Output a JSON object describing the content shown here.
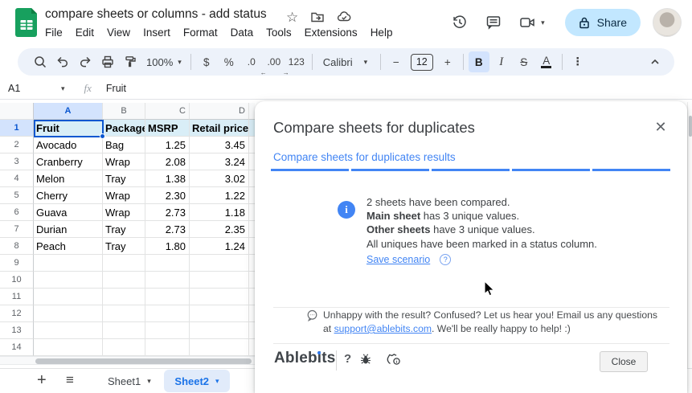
{
  "titlebar": {
    "doc_title": "compare sheets or columns - add status",
    "menu_items": [
      "File",
      "Edit",
      "View",
      "Insert",
      "Format",
      "Data",
      "Tools",
      "Extensions",
      "Help"
    ],
    "share_label": "Share"
  },
  "toolbar": {
    "zoom_value": "100%",
    "currency": "$",
    "percent": "%",
    "decimal_decrease": ".0",
    "decimal_increase": ".00",
    "more_formats": "123",
    "font_name": "Calibri",
    "minus": "−",
    "font_size": "12",
    "plus": "+",
    "bold": "B",
    "italic": "I",
    "strikethrough": "S",
    "text_color": "A",
    "more": "⋮"
  },
  "icons": {
    "caret_down": "▾",
    "arrow_left": "←",
    "arrow_right": "→",
    "star": "☆",
    "plus": "+",
    "all_sheets": "≡",
    "close": "✕",
    "question": "?",
    "info": "i"
  },
  "formula_bar": {
    "cell_ref": "A1",
    "fx_label": "fx",
    "value": "Fruit"
  },
  "grid": {
    "col_headers": [
      "A",
      "B",
      "C",
      "D"
    ],
    "row_numbers": [
      "1",
      "2",
      "3",
      "4",
      "5",
      "6",
      "7",
      "8",
      "9",
      "10",
      "11",
      "12",
      "13",
      "14"
    ],
    "rows": [
      [
        "Fruit",
        "Package",
        "MSRP",
        "Retail price"
      ],
      [
        "Avocado",
        "Bag",
        "1.25",
        "3.45"
      ],
      [
        "Cranberry",
        "Wrap",
        "2.08",
        "3.24"
      ],
      [
        "Melon",
        "Tray",
        "1.38",
        "3.02"
      ],
      [
        "Cherry",
        "Wrap",
        "2.30",
        "1.22"
      ],
      [
        "Guava",
        "Wrap",
        "2.73",
        "1.18"
      ],
      [
        "Durian",
        "Tray",
        "2.73",
        "2.35"
      ],
      [
        "Peach",
        "Tray",
        "1.80",
        "1.24"
      ],
      [
        "",
        "",
        "",
        ""
      ],
      [
        "",
        "",
        "",
        ""
      ],
      [
        "",
        "",
        "",
        ""
      ],
      [
        "",
        "",
        "",
        ""
      ],
      [
        "",
        "",
        "",
        ""
      ],
      [
        "",
        "",
        "",
        ""
      ]
    ]
  },
  "sheet_bar": {
    "sheet1": "Sheet1",
    "sheet2": "Sheet2"
  },
  "dialog": {
    "title": "Compare sheets for duplicates",
    "results_link": "Compare sheets for duplicates results",
    "info": {
      "line1": "2 sheets have been compared.",
      "line2_bold": "Main sheet",
      "line2_rest": " has 3 unique values.",
      "line3_bold": "Other sheets",
      "line3_rest": " have 3 unique values.",
      "line4": "All uniques have been marked in a status column."
    },
    "save_scenario": "Save scenario",
    "feedback": {
      "line1": "Unhappy with the result? Confused? Let us hear you! Email us any questions",
      "line2_prefix": "at ",
      "email": "support@ablebits.com",
      "line2_suffix": ". We'll be really happy to help! :)"
    },
    "footer": {
      "brand": "Ablebits",
      "help": "?",
      "close_label": "Close"
    }
  },
  "colors": {
    "accent_blue": "#1a73e8",
    "link_blue": "#4285f4",
    "selection_blue": "#0b57d0",
    "share_pill": "#c2e7ff",
    "header_row_fill": "#d9eef7",
    "selected_header_fill": "#d3e3fd",
    "active_tab_fill": "#e1ebfa",
    "sheets_green": "#17a05e",
    "toolbar_bg": "#edf2fa"
  }
}
